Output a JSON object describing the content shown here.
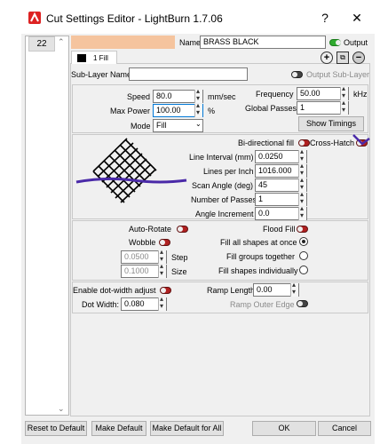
{
  "window": {
    "title": "Cut Settings Editor - LightBurn 1.7.06",
    "help": "?",
    "close": "✕"
  },
  "layer": {
    "number": "22",
    "name_label": "Name",
    "name_value": "BRASS BLACK",
    "output_label": "Output",
    "color": "#f5c49e"
  },
  "tab": {
    "label": "1 Fill"
  },
  "sublayer": {
    "label": "Sub-Layer Name",
    "value": "",
    "output_label": "Output Sub-Layer"
  },
  "speed": {
    "label": "Speed",
    "value": "80.0",
    "unit": "mm/sec"
  },
  "max_power": {
    "label": "Max Power",
    "value": "100.00",
    "unit": "%"
  },
  "mode": {
    "label": "Mode",
    "value": "Fill"
  },
  "frequency": {
    "label": "Frequency",
    "value": "50.00",
    "unit": "kHz"
  },
  "global_passes": {
    "label": "Global Passes",
    "value": "1"
  },
  "show_timings": {
    "label": "Show Timings"
  },
  "fill": {
    "bidirectional_label": "Bi-directional fill",
    "crosshatch_label": "Cross-Hatch",
    "line_interval_label": "Line Interval (mm)",
    "line_interval": "0.0250",
    "lines_per_inch_label": "Lines per Inch",
    "lines_per_inch": "1016.000",
    "scan_angle_label": "Scan Angle (deg)",
    "scan_angle": "45",
    "num_passes_label": "Number of Passes",
    "num_passes": "1",
    "angle_increment_label": "Angle Increment",
    "angle_increment": "0.0"
  },
  "options": {
    "auto_rotate": "Auto-Rotate",
    "flood_fill": "Flood Fill",
    "wobble": "Wobble",
    "fill_all": "Fill all shapes at once",
    "step_value": "0.0500",
    "step_label": "Step",
    "fill_groups": "Fill groups together",
    "size_value": "0.1000",
    "size_label": "Size",
    "fill_individually": "Fill shapes individually"
  },
  "dot": {
    "enable_label": "Enable dot-width adjust",
    "width_label": "Dot Width:",
    "width_value": "0.080",
    "ramp_length_label": "Ramp Length",
    "ramp_length_value": "0.00",
    "ramp_outer_label": "Ramp Outer Edge"
  },
  "buttons": {
    "reset": "Reset to Default",
    "make_default": "Make Default",
    "make_default_all": "Make Default for All",
    "ok": "OK",
    "cancel": "Cancel"
  },
  "icons": {
    "add": "plus-circle-icon",
    "copy": "copy-icon",
    "remove": "minus-circle-icon"
  }
}
